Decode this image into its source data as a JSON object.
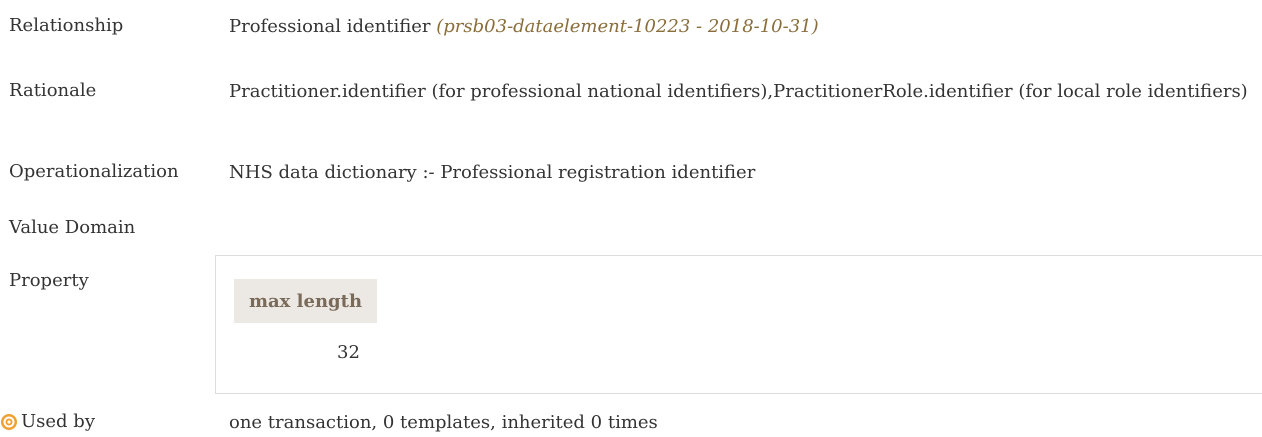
{
  "rows": {
    "relationship": {
      "label": "Relationship",
      "value": "Professional identifier",
      "ref": "(prsb03-dataelement-10223 - 2018-10-31)"
    },
    "rationale": {
      "label": "Rationale",
      "value": "Practitioner.identifier (for professional national identifiers),PractitionerRole.identifier (for local role identifiers)"
    },
    "operationalization": {
      "label": "Operationalization",
      "value": "NHS data dictionary :- Professional registration identifier"
    },
    "value_domain": {
      "label": "Value Domain"
    },
    "property": {
      "label": "Property",
      "header": "max length",
      "value": "32"
    },
    "used_by": {
      "label": "Used by",
      "value": "one transaction, 0 templates, inherited 0 times",
      "icon": "target-icon"
    }
  },
  "colors": {
    "text": "#333333",
    "reference_italic": "#8a6d3b",
    "property_header_bg": "#ece8e3",
    "icon_orange": "#f0a030"
  }
}
